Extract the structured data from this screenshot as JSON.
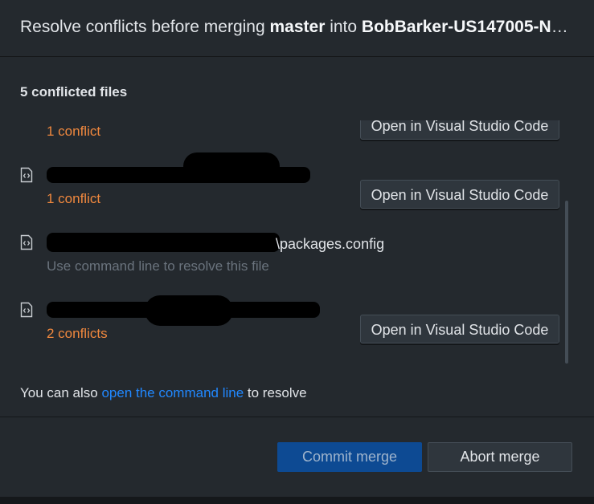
{
  "dialog": {
    "title_prefix": "Resolve conflicts before merging ",
    "source_branch": "master",
    "title_middle": " into ",
    "target_branch": "BobBarker-US147005-Ne…"
  },
  "conflict_count_label": "5 conflicted files",
  "files": [
    {
      "status": "1 conflict",
      "action": "Open in Visual Studio Code"
    },
    {
      "status": "1 conflict",
      "action": "Open in Visual Studio Code"
    },
    {
      "name_visible": "\\packages.config",
      "status": "Use command line to resolve this file"
    },
    {
      "status": "2 conflicts",
      "action": "Open in Visual Studio Code"
    }
  ],
  "footer": {
    "prefix": "You can also ",
    "link": "open the command line",
    "suffix": " to resolve"
  },
  "buttons": {
    "commit": "Commit merge",
    "abort": "Abort merge"
  },
  "colors": {
    "conflict": "#f0883e",
    "link": "#2188ff",
    "primary": "#0d4a93"
  }
}
